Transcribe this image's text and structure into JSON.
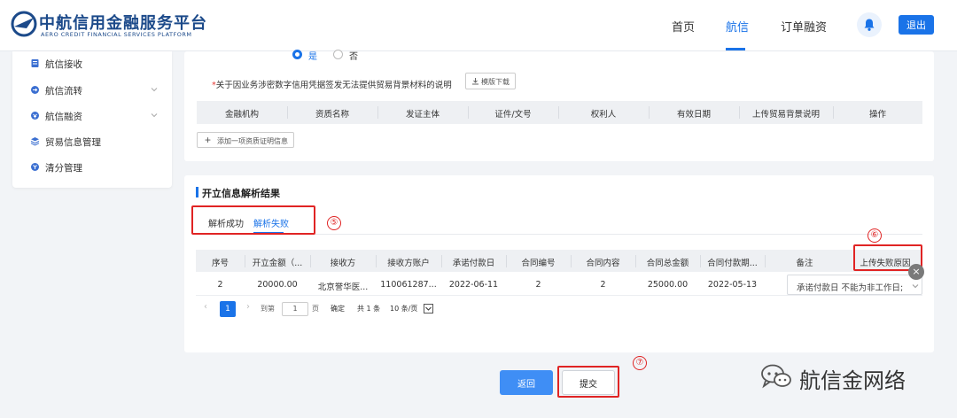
{
  "header": {
    "logo_cn": "中航信用金融服务平台",
    "logo_en": "AERO CREDIT FINANCIAL SERVICES PLATFORM",
    "nav": [
      {
        "label": "首页",
        "active": false
      },
      {
        "label": "航信",
        "active": true
      },
      {
        "label": "订单融资",
        "active": false
      }
    ],
    "bell_icon": "bell-icon",
    "logout_label": "退出",
    "accent_color": "#1a73e8"
  },
  "sidebar": {
    "items": [
      {
        "label": "航信接收",
        "icon": "doc-icon",
        "expandable": false
      },
      {
        "label": "航信流转",
        "icon": "flow-icon",
        "expandable": true
      },
      {
        "label": "航信融资",
        "icon": "finance-icon",
        "expandable": true
      },
      {
        "label": "贸易信息管理",
        "icon": "stack-icon",
        "expandable": false
      },
      {
        "label": "清分管理",
        "icon": "coin-icon",
        "expandable": false
      }
    ]
  },
  "qualification": {
    "radio_yes": "是",
    "radio_no": "否",
    "radio_selected": "是",
    "note_required": "*",
    "note": "关于因业务涉密数字信用凭据签发无法提供贸易背景材料的说明",
    "template_download": "模版下载",
    "table_headers": [
      "金融机构",
      "资质名称",
      "发证主体",
      "证件/文号",
      "权利人",
      "有效日期",
      "上传贸易背景说明",
      "操作"
    ],
    "add_button": "添加一项资质证明信息"
  },
  "parse_result": {
    "title": "开立信息解析结果",
    "tabs": [
      {
        "label": "解析成功",
        "active": false
      },
      {
        "label": "解析失败",
        "active": true
      }
    ],
    "headers": [
      "序号",
      "开立金额（...",
      "接收方",
      "接收方账户",
      "承诺付款日",
      "合同编号",
      "合同内容",
      "合同总金额",
      "合同付款期...",
      "备注",
      "上传失败原因"
    ],
    "rows": [
      {
        "cells": [
          "2",
          "20000.00",
          "北京誉华医...",
          "110061287...",
          "2022-06-11",
          "2",
          "2",
          "25000.00",
          "2022-05-13"
        ],
        "remark": "承诺付款日 不能为非工作日;"
      }
    ],
    "pagination": {
      "prev": "‹",
      "current": "1",
      "next": "›",
      "goto_label": "到第",
      "goto_value": "1",
      "page_unit": "页",
      "confirm": "确定",
      "total": "共 1 条",
      "page_size": "10 条/页"
    },
    "clear_icon": "clear-icon"
  },
  "annotations": {
    "step5": "⑤",
    "step6": "⑥",
    "step7": "⑦",
    "highlight_color": "#e02424"
  },
  "footer": {
    "back_label": "返回",
    "submit_label": "提交"
  },
  "watermark": {
    "text": "航信金网络",
    "icon": "wechat-icon"
  }
}
